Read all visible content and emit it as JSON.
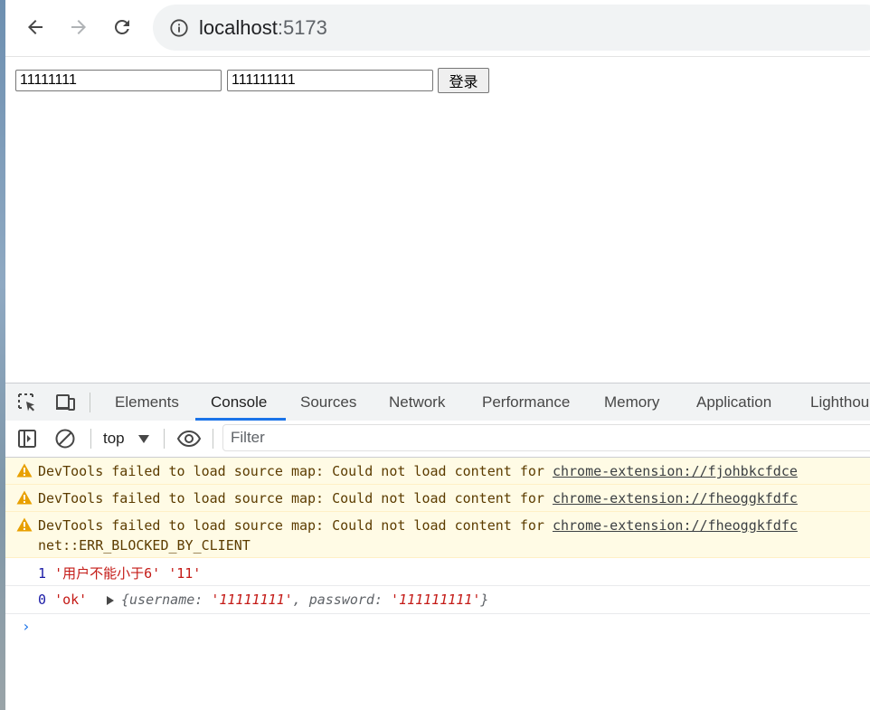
{
  "browser": {
    "url_host": "localhost",
    "url_port": ":5173"
  },
  "page": {
    "username_value": "11111111",
    "password_value": "111111111",
    "login_label": "登录"
  },
  "devtools": {
    "tabs": [
      "Elements",
      "Console",
      "Sources",
      "Network",
      "Performance",
      "Memory",
      "Application",
      "Lighthou"
    ],
    "active_tab": "Console",
    "context": "top",
    "filter_placeholder": "Filter",
    "warnings": [
      {
        "text": "DevTools failed to load source map: Could not load content for ",
        "link": "chrome-extension://fjohbkcfdce"
      },
      {
        "text": "DevTools failed to load source map: Could not load content for ",
        "link": "chrome-extension://fheoggkfdfc"
      },
      {
        "text": "DevTools failed to load source map: Could not load content for ",
        "link": "chrome-extension://fheoggkfdfc",
        "line2": "net::ERR_BLOCKED_BY_CLIENT"
      }
    ],
    "logs": [
      {
        "count": "1",
        "msg": "'用户不能小于6'",
        "extra": "'11'"
      },
      {
        "count": "0",
        "msg": "'ok'",
        "obj_open": "{",
        "k1": "username",
        "v1": "'11111111'",
        "k2": "password",
        "v2": "'111111111'",
        "obj_close": "}"
      }
    ],
    "prompt": "›"
  },
  "colors": {
    "accent": "#1a73e8",
    "warning_bg": "#fffbe5",
    "warning_icon": "#e8a000",
    "string": "#c41a16"
  }
}
